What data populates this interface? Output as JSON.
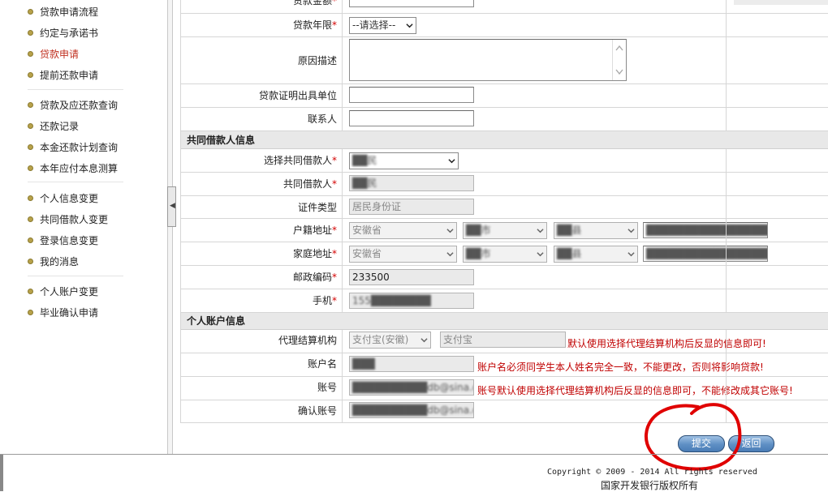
{
  "sidebar": {
    "groups": [
      [
        {
          "label": "贷款申请流程",
          "active": false
        },
        {
          "label": "约定与承诺书",
          "active": false
        },
        {
          "label": "贷款申请",
          "active": true
        },
        {
          "label": "提前还款申请",
          "active": false
        }
      ],
      [
        {
          "label": "贷款及应还款查询",
          "active": false
        },
        {
          "label": "还款记录",
          "active": false
        },
        {
          "label": "本金还款计划查询",
          "active": false
        },
        {
          "label": "本年应付本息测算",
          "active": false
        }
      ],
      [
        {
          "label": "个人信息变更",
          "active": false
        },
        {
          "label": "共同借款人变更",
          "active": false
        },
        {
          "label": "登录信息变更",
          "active": false
        },
        {
          "label": "我的消息",
          "active": false
        }
      ],
      [
        {
          "label": "个人账户变更",
          "active": false
        },
        {
          "label": "毕业确认申请",
          "active": false
        }
      ]
    ],
    "toggle_icon": "chevron-left-icon"
  },
  "form": {
    "loan_amount": {
      "label": "贷款金额",
      "required": "*"
    },
    "loan_term": {
      "label": "贷款年限",
      "required": "*",
      "value": "--请选择--"
    },
    "reason": {
      "label": "原因描述"
    },
    "cert_unit": {
      "label": "贷款证明出具单位"
    },
    "contact": {
      "label": "联系人"
    },
    "co_borrower_section": "共同借款人信息",
    "select_co_borrower": {
      "label": "选择共同借款人",
      "required": "*",
      "value": "██民"
    },
    "co_borrower": {
      "label": "共同借款人",
      "required": "*",
      "value": "██民"
    },
    "id_type": {
      "label": "证件类型",
      "value": "居民身份证"
    },
    "hukou": {
      "label": "户籍地址",
      "required": "*",
      "province": "安徽省",
      "city": "██市",
      "county": "██县",
      "detail": "██████████████████"
    },
    "home": {
      "label": "家庭地址",
      "required": "*",
      "province": "安徽省",
      "city": "██市",
      "county": "██县",
      "detail": "██████████████████"
    },
    "postcode": {
      "label": "邮政编码",
      "required": "*",
      "value": "233500"
    },
    "mobile": {
      "label": "手机",
      "required": "*",
      "value": "155████████"
    },
    "account_section": "个人账户信息",
    "agent": {
      "label": "代理结算机构",
      "select": "支付宝(安徽)",
      "value": "支付宝",
      "note": "默认使用选择代理结算机构后反显的信息即可!"
    },
    "account_name": {
      "label": "账户名",
      "value": "███",
      "note": "账户名必须同学生本人姓名完全一致，不能更改，否则将影响贷款!"
    },
    "account_no": {
      "label": "账号",
      "value": "██████████db@sina.c",
      "note": "账号默认使用选择代理结算机构后反显的信息即可，不能修改成其它账号!"
    },
    "confirm_no": {
      "label": "确认账号",
      "value": "██████████db@sina.c"
    }
  },
  "buttons": {
    "submit": "提交",
    "back": "返回"
  },
  "footer": {
    "copyright": "Copyright © 2009 - 2014 All rights reserved",
    "owner": "国家开发银行版权所有"
  },
  "colors": {
    "active_nav": "#c03020",
    "warning": "#c00000",
    "annotation_circle": "#e00000"
  }
}
